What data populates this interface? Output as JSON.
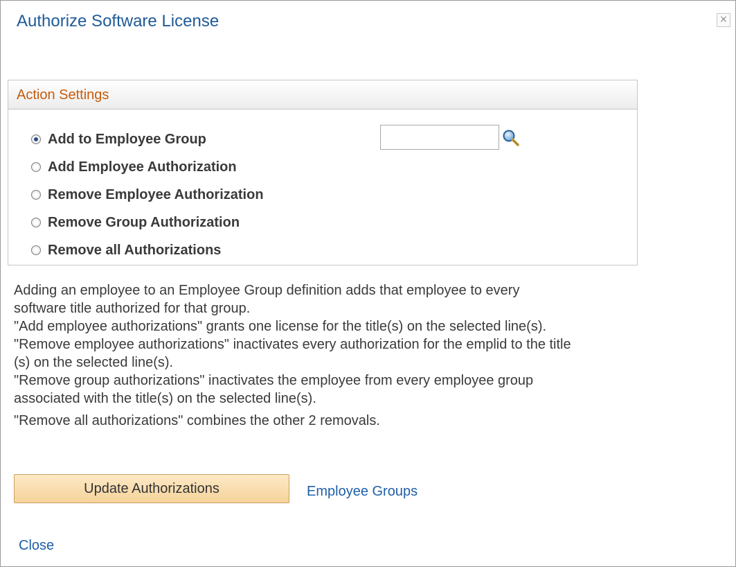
{
  "window": {
    "title": "Authorize Software License",
    "close_glyph": "×"
  },
  "action_settings": {
    "header": "Action Settings",
    "options": [
      {
        "label": "Add to Employee Group",
        "selected": true
      },
      {
        "label": "Add Employee Authorization",
        "selected": false
      },
      {
        "label": "Remove Employee Authorization",
        "selected": false
      },
      {
        "label": "Remove Group Authorization",
        "selected": false
      },
      {
        "label": "Remove all Authorizations",
        "selected": false
      }
    ],
    "group_input": {
      "value": "",
      "icon": "magnifier-icon"
    }
  },
  "description": [
    "Adding an employee to an Employee Group definition adds that employee to every",
    "software title authorized for that group.",
    "\"Add employee authorizations\" grants one license for the title(s) on the selected line(s).",
    "\"Remove employee authorizations\" inactivates every authorization for the emplid to the title",
    "(s) on the selected line(s).",
    "\"Remove group authorizations\" inactivates the employee from every employee group",
    "associated with the title(s) on the selected line(s).",
    "\"Remove all authorizations\" combines the other 2 removals."
  ],
  "actions": {
    "update_button": "Update Authorizations",
    "employee_groups_link": "Employee Groups",
    "close_link": "Close"
  },
  "colors": {
    "title": "#1f5a99",
    "group_header": "#c65b0a",
    "link": "#1f5fa8",
    "button_bg": "#f6d39a"
  }
}
